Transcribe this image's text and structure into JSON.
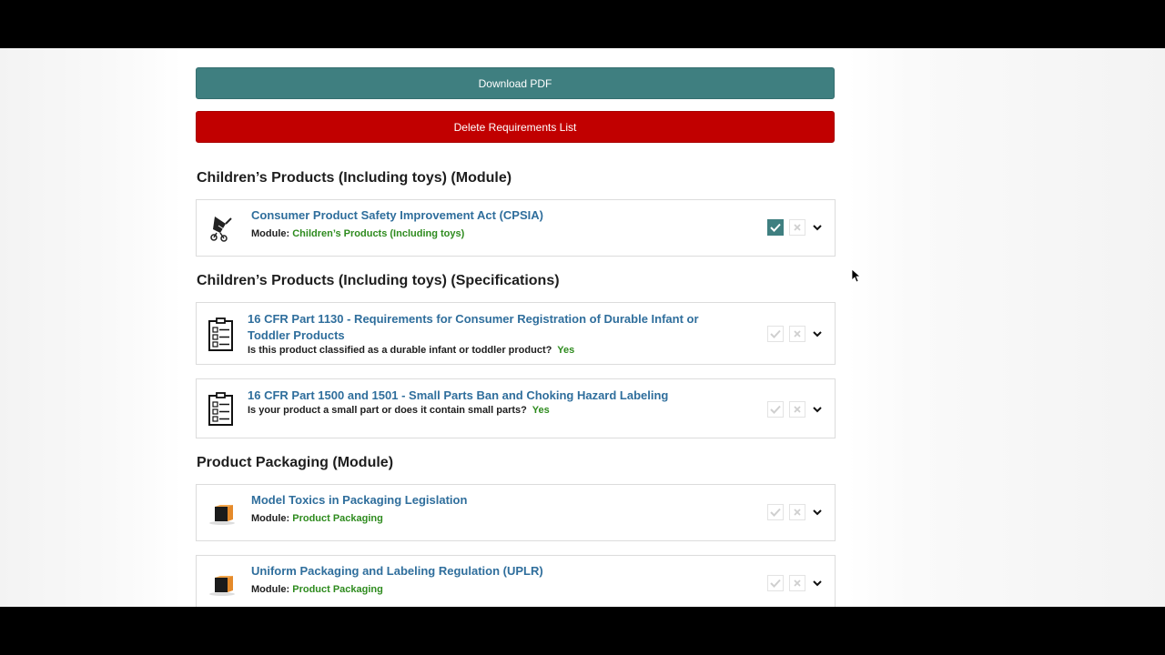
{
  "buttons": {
    "download": "Download PDF",
    "delete": "Delete Requirements List"
  },
  "sections": [
    {
      "title": "Children’s Products (Including toys) (Module)",
      "items": [
        {
          "title": "Consumer Product Safety Improvement Act (CPSIA)",
          "meta_label": "Module:",
          "meta_value": "Children’s Products (Including toys)",
          "icon": "stroller-icon",
          "checked": true
        }
      ]
    },
    {
      "title": "Children’s Products (Including toys) (Specifications)",
      "items": [
        {
          "title": "16 CFR Part 1130 - Requirements for Consumer Registration of Durable Infant or Toddler Products",
          "meta_label": "Is this product classified as a durable infant or toddler product?",
          "meta_value": "Yes",
          "icon": "checklist-icon",
          "checked": false
        },
        {
          "title": "16 CFR Part 1500 and 1501 - Small Parts Ban and Choking Hazard Labeling",
          "meta_label": "Is your product a small part or does it contain small parts?",
          "meta_value": "Yes",
          "icon": "checklist-icon",
          "checked": false
        }
      ]
    },
    {
      "title": "Product Packaging (Module)",
      "items": [
        {
          "title": "Model Toxics in Packaging Legislation",
          "meta_label": "Module:",
          "meta_value": "Product Packaging",
          "icon": "box-icon",
          "checked": false
        },
        {
          "title": "Uniform Packaging and Labeling Regulation (UPLR)",
          "meta_label": "Module:",
          "meta_value": "Product Packaging",
          "icon": "box-icon",
          "checked": false
        }
      ]
    }
  ],
  "colors": {
    "teal": "#3f7f80",
    "red": "#c10000",
    "link": "#2f6e9c",
    "green": "#2e8b1e"
  }
}
